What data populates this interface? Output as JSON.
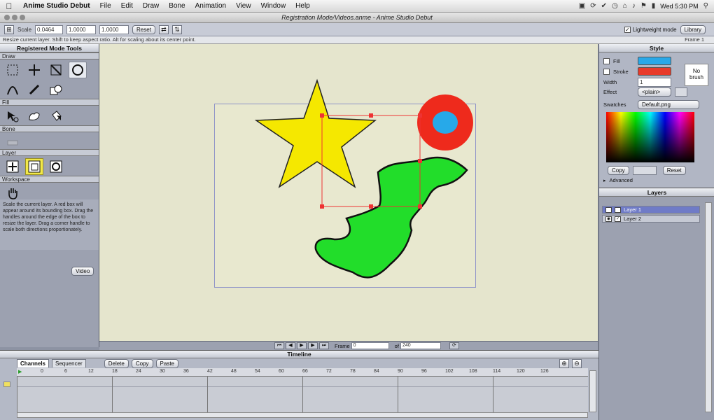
{
  "menubar": {
    "app": "Anime Studio Debut",
    "items": [
      "File",
      "Edit",
      "Draw",
      "Bone",
      "Animation",
      "View",
      "Window",
      "Help"
    ],
    "clock": "Wed 5:30 PM"
  },
  "window": {
    "title": "Registration Mode/Videos.anme - Anime Studio Debut"
  },
  "options": {
    "scale_label": "Scale",
    "scale_x": "0.0464",
    "scale_y": "1.0000",
    "scale_z": "1.0000",
    "reset": "Reset",
    "lightweight_label": "Lightweight mode",
    "library": "Library"
  },
  "hint": "Resize current layer. Shift to keep aspect ratio. Alt for scaling about its center point.",
  "frame_indicator": "Frame 1",
  "tools": {
    "title": "Registered Mode Tools",
    "sections": {
      "draw": "Draw",
      "fill": "Fill",
      "bone": "Bone",
      "layer": "Layer",
      "workspace": "Workspace"
    },
    "description": "Scale the current layer. A red box will appear around its bounding box. Drag the handles around the edge of the box to resize the layer. Drag a corner handle to scale both directions proportionately.",
    "video": "Video"
  },
  "nav": {
    "frame_label": "Frame",
    "frame_value": "0",
    "of_label": "of",
    "of_value": "240"
  },
  "timeline": {
    "title": "Timeline",
    "tabs": [
      "Channels",
      "Sequencer"
    ],
    "buttons": [
      "Delete",
      "Copy",
      "Paste"
    ],
    "ruler": [
      "0",
      "6",
      "12",
      "18",
      "24",
      "30",
      "36",
      "42",
      "48",
      "54",
      "60",
      "66",
      "72",
      "78",
      "84",
      "90",
      "96",
      "102",
      "108",
      "114",
      "120",
      "126"
    ]
  },
  "style": {
    "title": "Style",
    "fill_label": "Fill",
    "stroke_label": "Stroke",
    "width_label": "Width",
    "width_value": "1",
    "effect_label": "Effect",
    "effect_value": "<plain>",
    "swatches_label": "Swatches",
    "swatches_value": "Default.png",
    "no_brush": "No brush",
    "copy": "Copy",
    "reset": "Reset",
    "advanced": "Advanced",
    "fill_color": "#29a8e8",
    "stroke_color": "#e83a2a"
  },
  "layers": {
    "title": "Layers",
    "items": [
      "Layer 1",
      "Layer 2"
    ]
  }
}
